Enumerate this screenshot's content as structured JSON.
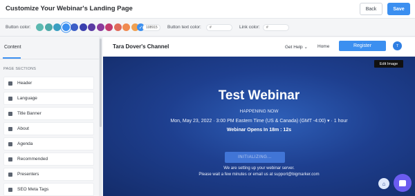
{
  "header": {
    "title": "Customize Your Webinar's Landing Page",
    "back_label": "Back",
    "save_label": "Save"
  },
  "colors": {
    "button_color_label": "Button color:",
    "swatches": [
      "#5bb8b0",
      "#4ca9a8",
      "#3a9fc2",
      "#3b8ff0",
      "#3d5fc7",
      "#3a3fae",
      "#5a3aa3",
      "#8a3a9c",
      "#c23a6e",
      "#e06a5a",
      "#f08a50",
      "#f0a050"
    ],
    "selected_swatch_index": 3,
    "button_hex": "108915",
    "button_text_color_label": "Button text color:",
    "button_text_hex_placeholder": "#",
    "link_color_label": "Link color:",
    "link_hex_placeholder": "#"
  },
  "left_panel": {
    "tab": "Content",
    "sections_heading": "PAGE SECTIONS",
    "sections": [
      {
        "label": "Header",
        "icon": "header-icon"
      },
      {
        "label": "Language",
        "icon": "language-icon"
      },
      {
        "label": "Title Banner",
        "icon": "title-banner-icon"
      },
      {
        "label": "About",
        "icon": "about-icon"
      },
      {
        "label": "Agenda",
        "icon": "agenda-icon"
      },
      {
        "label": "Recommended",
        "icon": "recommended-icon"
      },
      {
        "label": "Presenters",
        "icon": "presenters-icon"
      },
      {
        "label": "SEO Meta Tags",
        "icon": "seo-icon"
      }
    ]
  },
  "preview": {
    "channel_name": "Tara Dover's Channel",
    "nav_get_help": "Get Help ⌄",
    "nav_home": "Home",
    "register_label": "Register",
    "avatar_initial": "T",
    "edit_image_label": "Edit Image",
    "title": "Test Webinar",
    "happening": "HAPPENING NOW",
    "date_line": "Mon, May 23, 2022 · 3:00 PM Eastern Time (US & Canada) (GMT -4:00)  ▾  · 1 hour",
    "opens_in": "Webinar Opens In 18m : 12s",
    "initializing_label": "INITIALIZING...",
    "message_line1": "We are setting up your webinar server.",
    "message_line2": "Please wait a few minutes or email us at support@bigmarker.com"
  }
}
